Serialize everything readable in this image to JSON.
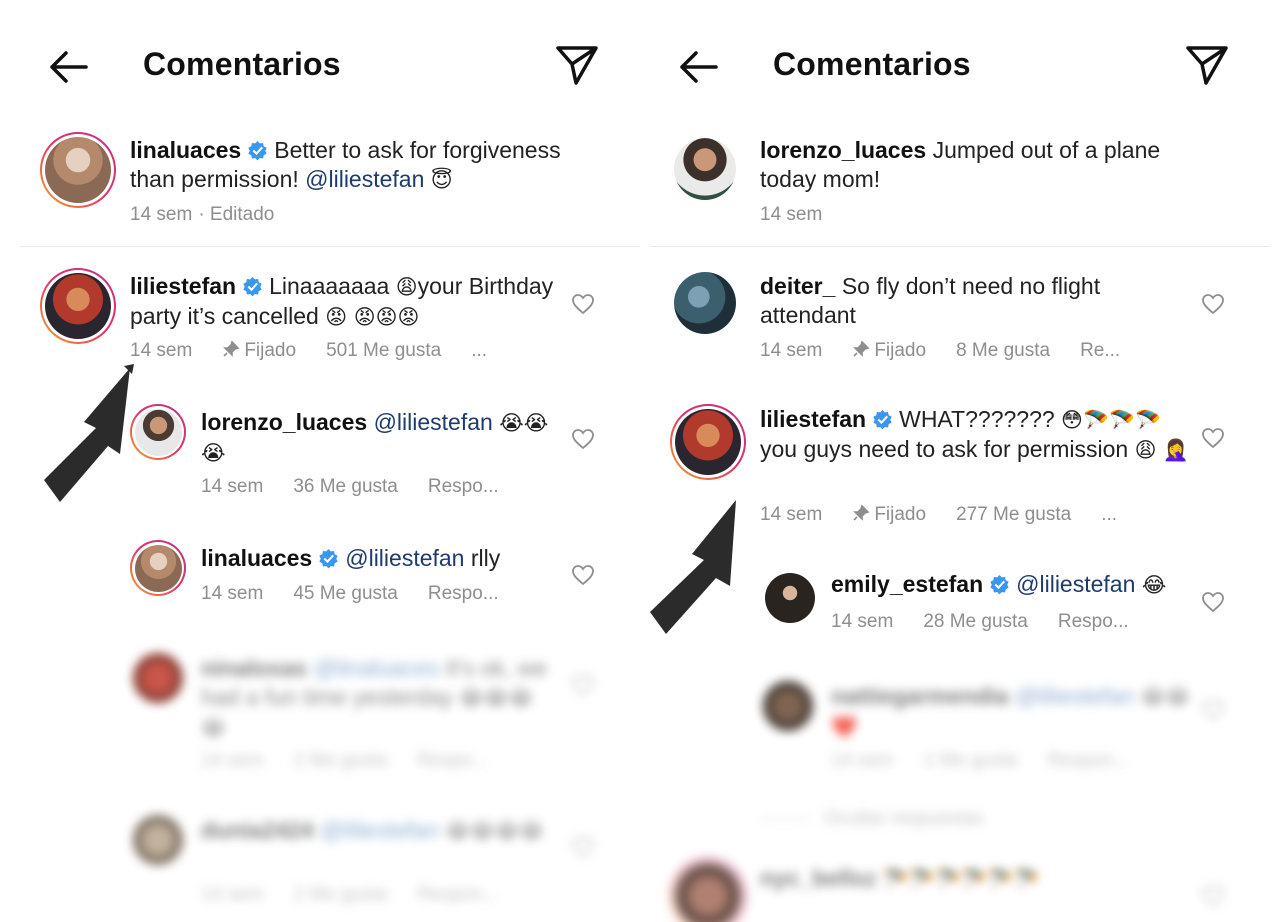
{
  "left": {
    "header": {
      "title": "Comentarios"
    },
    "caption": {
      "user": "linaluaces",
      "text": "Better to ask for forgiveness than permission!",
      "mention": "@liliestefan",
      "emoji": "😇",
      "time": "14 sem",
      "edited": "· Editado"
    },
    "pinned": {
      "user": "liliestefan",
      "text_a": "Linaaaaaaa",
      "emoji_a": "😩",
      "text_b": "your Birthday party it’s cancelled",
      "emoji_b": "😡 😡😡😡",
      "time": "14 sem",
      "pinned_label": "Fijado",
      "likes": "501 Me gusta",
      "more": "..."
    },
    "reply1": {
      "user": "lorenzo_luaces",
      "mention": "@liliestefan",
      "emoji": "😭😭😭",
      "time": "14 sem",
      "likes": "36 Me gusta",
      "reply": "Respo..."
    },
    "reply2": {
      "user": "linaluaces",
      "mention": "@liliestefan",
      "text": "rlly",
      "time": "14 sem",
      "likes": "45 Me gusta",
      "reply": "Respo..."
    },
    "blurred1": {
      "user": "ninaloxas",
      "mention": "@linaluaces",
      "text": "It's ok, we had a fun time yesterday",
      "emoji": "😂😂😂😂",
      "time": "14 sem",
      "likes": "2 Me gusta",
      "reply": "Respo..."
    },
    "blurred2": {
      "user": "dunia2424",
      "mention": "@liliestefan",
      "emoji": "😂😂😂😂",
      "time": "14 sem",
      "likes": "2 Me gusta",
      "reply": "Respon..."
    }
  },
  "right": {
    "header": {
      "title": "Comentarios"
    },
    "caption": {
      "user": "lorenzo_luaces",
      "text": "Jumped out of a plane today mom!",
      "time": "14 sem"
    },
    "comment1": {
      "user": "deiter_",
      "text": "So fly don’t need no flight attendant",
      "time": "14 sem",
      "pinned_label": "Fijado",
      "likes": "8 Me gusta",
      "reply": "Re..."
    },
    "pinned": {
      "user": "liliestefan",
      "text_a": "WHAT???????",
      "emoji_a": "😳🪂🪂🪂",
      "text_b": "you guys need to ask for permission",
      "emoji_b": "😩",
      "emoji_c": "🤦‍♀️",
      "time": "14 sem",
      "pinned_label": "Fijado",
      "likes": "277 Me gusta",
      "more": "..."
    },
    "reply1": {
      "user": "emily_estefan",
      "mention": "@liliestefan",
      "emoji": "😂",
      "time": "14 sem",
      "likes": "28 Me gusta",
      "reply": "Respo..."
    },
    "blurred1": {
      "user": "nattiegarmendia",
      "mention": "@liliestefan",
      "emoji": "😂😂❤️",
      "time": "14 sem",
      "likes": "1 Me gusta",
      "reply": "Respon...",
      "hide": "Ocultar respuestas"
    },
    "blurred2": {
      "user": "nyc_bellsz",
      "emoji": "🪂🪂🪂🪂🪂🪂"
    }
  },
  "icons": {
    "back": "arrow-left-icon",
    "share": "paper-plane-icon",
    "heart": "heart-outline-icon",
    "verified": "verified-badge-icon",
    "pin": "pin-icon",
    "annotation": "black-arrow"
  },
  "colors": {
    "verified": "#3897f0",
    "mention": "#1e3a6e",
    "meta": "#8e8e8e"
  }
}
